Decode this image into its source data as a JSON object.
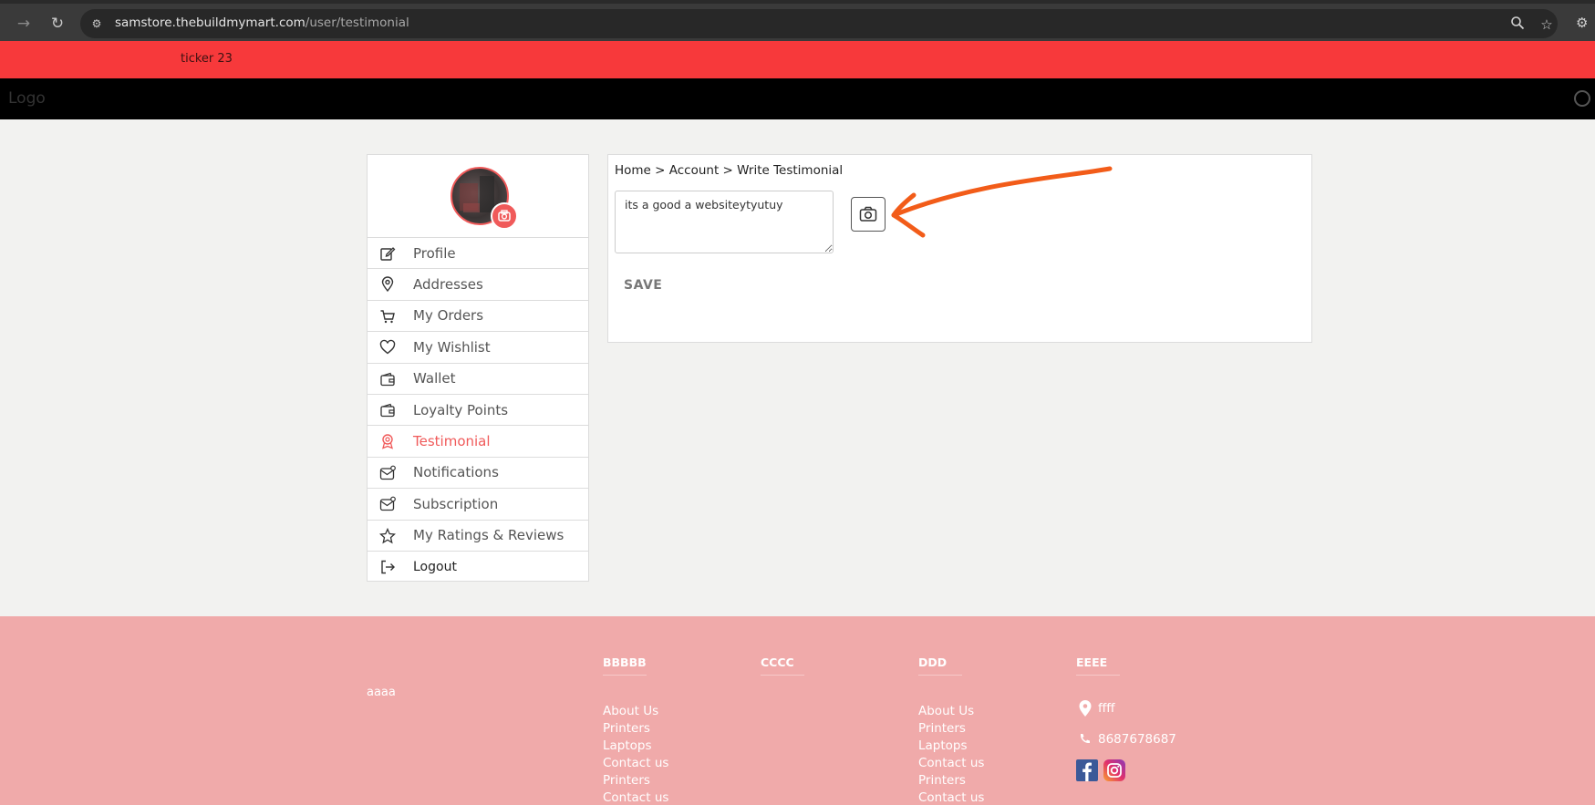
{
  "browser": {
    "url_domain": "samstore.thebuildmymart.com",
    "url_path": "/user/testimonial"
  },
  "ticker": {
    "text": "ticker 23"
  },
  "header": {
    "logo": "Logo"
  },
  "sidebar": {
    "items": [
      {
        "label": "Profile",
        "icon": "edit-icon"
      },
      {
        "label": "Addresses",
        "icon": "location-pin-icon"
      },
      {
        "label": "My Orders",
        "icon": "cart-icon"
      },
      {
        "label": "My Wishlist",
        "icon": "heart-icon"
      },
      {
        "label": "Wallet",
        "icon": "wallet-icon"
      },
      {
        "label": "Loyalty Points",
        "icon": "wallet-icon"
      },
      {
        "label": "Testimonial",
        "icon": "award-icon",
        "active": true
      },
      {
        "label": "Notifications",
        "icon": "mail-icon"
      },
      {
        "label": "Subscription",
        "icon": "mail-icon"
      },
      {
        "label": "My Ratings & Reviews",
        "icon": "star-icon"
      },
      {
        "label": "Logout",
        "icon": "logout-icon"
      }
    ]
  },
  "main": {
    "breadcrumb": "Home > Account > Write Testimonial",
    "testimonial_value": "its a good a websiteytyutuy",
    "save_label": "SAVE"
  },
  "footer": {
    "text": "aaaa",
    "columns": [
      {
        "heading": "BBBBB",
        "links": [
          "About Us",
          "Printers",
          "Laptops",
          "Contact us",
          "Printers",
          "Contact us"
        ]
      },
      {
        "heading": "CCCC",
        "links": []
      },
      {
        "heading": "DDD",
        "links": [
          "About Us",
          "Printers",
          "Laptops",
          "Contact us",
          "Printers",
          "Contact us"
        ]
      },
      {
        "heading": "EEEE",
        "links": []
      }
    ],
    "address": "ffff",
    "phone": "8687678687"
  },
  "colors": {
    "ticker": "#f7393b",
    "accent": "#f05a5a",
    "footer": "#f0aaaa",
    "annotation": "#f25c19"
  }
}
